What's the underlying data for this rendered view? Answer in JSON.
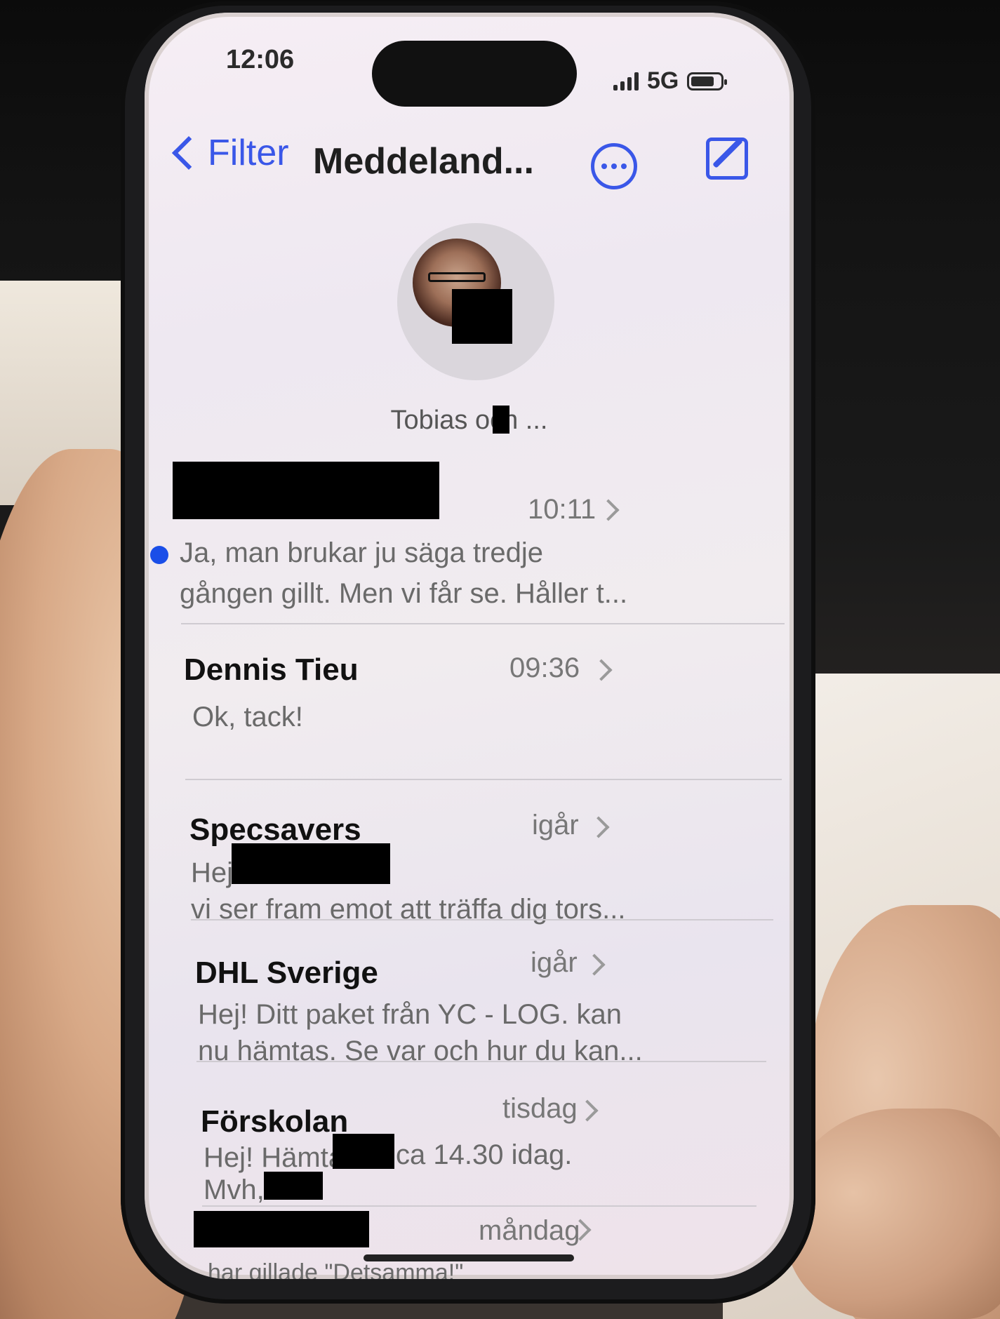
{
  "status_bar": {
    "time": "12:06",
    "network": "5G"
  },
  "nav": {
    "back_label": "Filter",
    "title": "Meddeland...",
    "more_icon": "ellipsis-circle-icon",
    "compose_icon": "compose-icon",
    "accent_color": "#3a57e8"
  },
  "pinned": {
    "label": "Tobias och ..."
  },
  "conversations": [
    {
      "name": "",
      "time": "10:11",
      "preview_line1": "Ja, man brukar ju säga tredje",
      "preview_line2": "gången gillt. Men vi får se. Håller t...",
      "unread": true
    },
    {
      "name": "Dennis Tieu",
      "time": "09:36",
      "preview_line1": "Ok, tack!",
      "preview_line2": ""
    },
    {
      "name": "Specsavers",
      "time": "igår",
      "preview_line1": "Hej",
      "preview_line2": "vi ser fram emot att träffa dig tors..."
    },
    {
      "name": "DHL Sverige",
      "time": "igår",
      "preview_line1": "Hej! Ditt paket från YC - LOG. kan",
      "preview_line2": "nu hämtas. Se var och hur du kan..."
    },
    {
      "name": "Förskolan",
      "time": "tisdag",
      "preview_line1": "Hej! Hämtar",
      "preview_line1b": "ca 14.30 idag.",
      "preview_line2": "Mvh,"
    },
    {
      "name": "",
      "time": "måndag",
      "preview_line1": "har gillade \"Detsamma!\"",
      "preview_line2": ""
    }
  ]
}
